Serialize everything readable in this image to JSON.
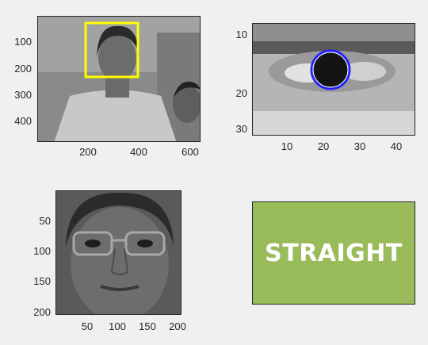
{
  "window": {
    "background": "#f0f0f0"
  },
  "panels": {
    "camera": {
      "y_ticks": [
        "100",
        "200",
        "300",
        "400"
      ],
      "x_ticks": [
        "200",
        "400",
        "600"
      ],
      "overlay": {
        "shape": "rectangle",
        "color": "#ffff00"
      }
    },
    "eye": {
      "y_ticks": [
        "10",
        "20",
        "30"
      ],
      "x_ticks": [
        "10",
        "20",
        "30",
        "40"
      ],
      "overlay": {
        "shape": "circle",
        "color": "#0000ff"
      }
    },
    "face": {
      "y_ticks": [
        "50",
        "100",
        "150",
        "200"
      ],
      "x_ticks": [
        "50",
        "100",
        "150",
        "200"
      ]
    },
    "status": {
      "label": "STRAIGHT",
      "color": "#9abb59",
      "text_color": "#ffffff"
    }
  }
}
